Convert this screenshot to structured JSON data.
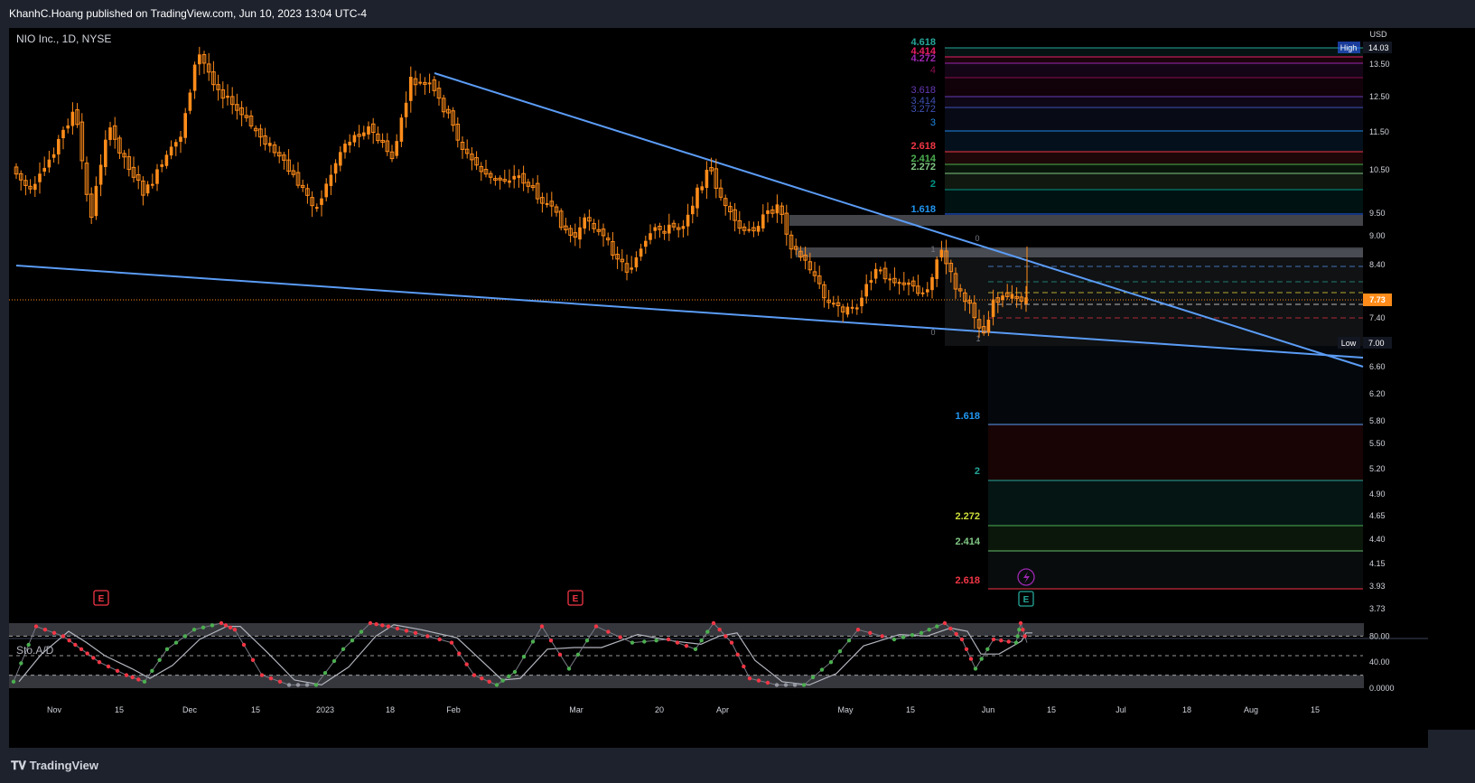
{
  "header": {
    "published": "KhanhC.Hoang published on TradingView.com, Jun 10, 2023 13:04 UTC-4"
  },
  "symbol": {
    "title": "NIO Inc., 1D, NYSE"
  },
  "indicator": {
    "label": "Sto.A/D"
  },
  "footer": {
    "brand": "TradingView"
  },
  "colors": {
    "candle": "#ff8c1a",
    "trend": "#5b9cf6",
    "bg": "#000000",
    "panel": "#1e222d"
  },
  "chart_data": {
    "type": "candlestick",
    "currency": "USD",
    "y_scale": "log",
    "ylim": [
      3.73,
      15.0
    ],
    "y_ticks": [
      "14.03",
      "13.50",
      "12.50",
      "11.50",
      "10.50",
      "9.50",
      "9.00",
      "8.40",
      "7.40",
      "7.00",
      "6.60",
      "6.20",
      "5.80",
      "5.50",
      "5.20",
      "4.90",
      "4.65",
      "4.40",
      "4.15",
      "3.93",
      "3.73"
    ],
    "x_ticks": [
      "Nov",
      "15",
      "Dec",
      "15",
      "2023",
      "18",
      "Feb",
      "Mar",
      "20",
      "Apr",
      "May",
      "15",
      "Jun",
      "15",
      "Jul",
      "18",
      "Aug",
      "15"
    ],
    "last_price": "7.73",
    "high_label": {
      "text": "High",
      "value": "14.03"
    },
    "low_label": {
      "text": "Low",
      "value": "7.00"
    },
    "fib_up_labels": [
      "4.618",
      "4.414",
      "4.272",
      "4",
      "3.618",
      "3.414",
      "3.272",
      "3",
      "2.618",
      "2.414",
      "2.272",
      "2",
      "1.618"
    ],
    "fib_down_labels": [
      "1.618",
      "2",
      "2.272",
      "2.414",
      "2.618"
    ],
    "fib_small_labels": [
      "0",
      "1",
      "0",
      "1"
    ],
    "earnings_label": "E",
    "oscillator": {
      "name": "Sto.A/D",
      "y_ticks": [
        "80.00",
        "40.00",
        "0.0000"
      ],
      "levels": [
        20,
        50,
        80
      ]
    }
  }
}
